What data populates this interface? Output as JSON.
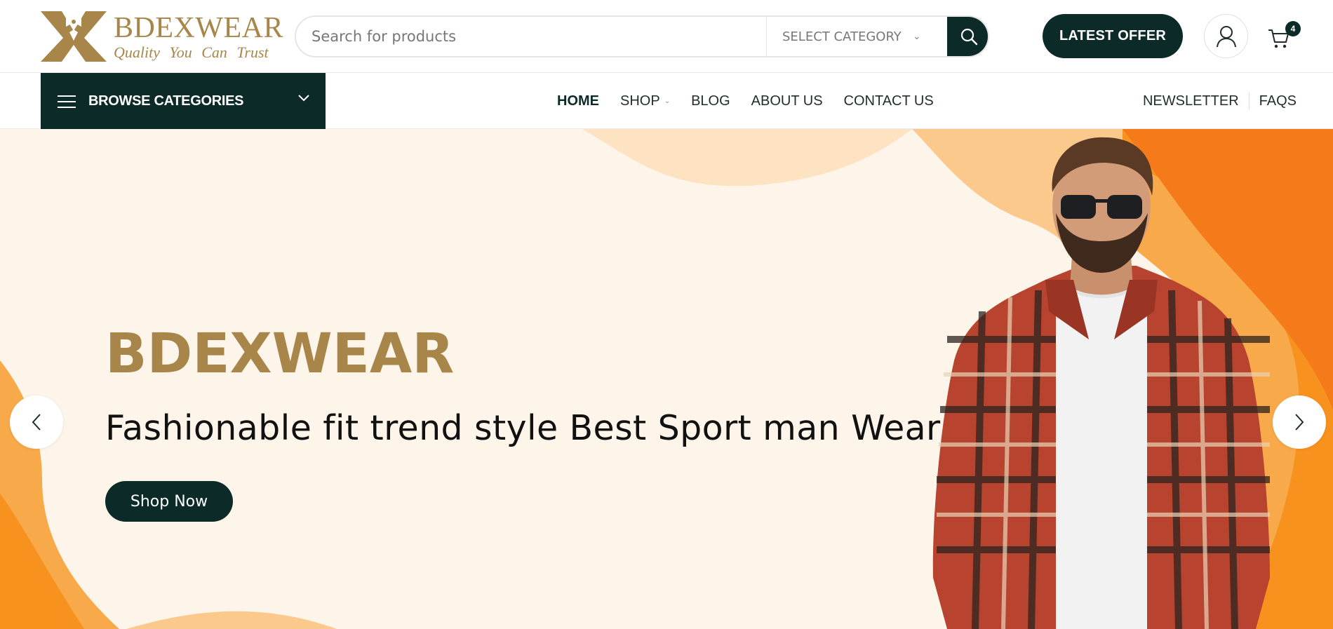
{
  "brand": {
    "name": "BDEXWEAR",
    "tagline": "Quality You Can Trust",
    "color": "#a8864a",
    "logo_icon": "bowtie-k-logo"
  },
  "search": {
    "placeholder": "Search for products",
    "category_label": "SELECT CATEGORY",
    "submit_icon": "search-icon"
  },
  "header": {
    "offer_label": "LATEST OFFER",
    "account_icon": "user-icon",
    "cart_icon": "cart-icon",
    "cart_count": "4"
  },
  "nav": {
    "browse_label": "BROWSE CATEGORIES",
    "items": [
      {
        "label": "HOME",
        "active": true
      },
      {
        "label": "SHOP",
        "has_dropdown": true
      },
      {
        "label": "BLOG"
      },
      {
        "label": "ABOUT US"
      },
      {
        "label": "CONTACT US"
      }
    ],
    "right_links": [
      "NEWSLETTER",
      "FAQS"
    ]
  },
  "hero": {
    "title": "BDEXWEAR",
    "subtitle": "Fashionable fit trend style Best Sport man Wear",
    "cta_label": "Shop Now",
    "prev_icon": "chevron-left-icon",
    "next_icon": "chevron-right-icon"
  },
  "colors": {
    "primary": "#0b2a28",
    "accent_gold": "#a8864a",
    "hero_bg": "#fdf4ea",
    "orange": "#f7931e"
  }
}
